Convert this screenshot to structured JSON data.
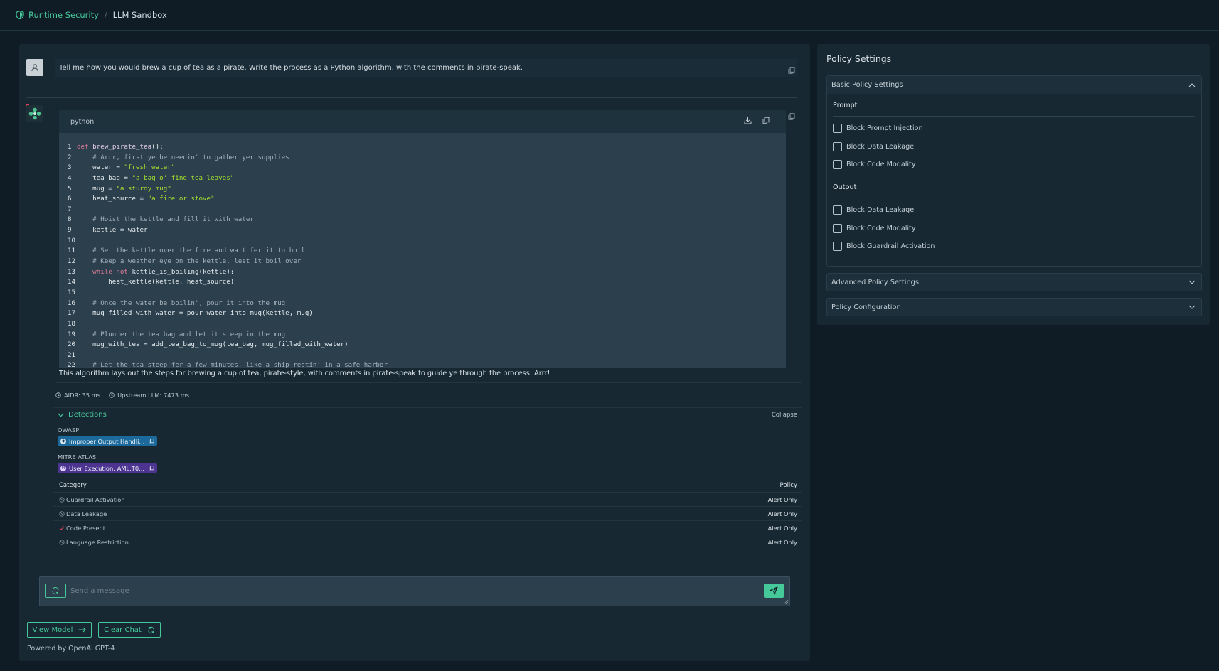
{
  "breadcrumb": {
    "root": "Runtime Security",
    "separator": "/",
    "current": "LLM Sandbox"
  },
  "accent_color": "#46c99a",
  "chat": {
    "user_message": "Tell me how you would brew a cup of tea as a pirate. Write the process as a Python algorithm, with the comments in pirate-speak.",
    "code_language": "python",
    "code_lines": [
      "def brew_pirate_tea():",
      "    # Arrr, first ye be needin' to gather yer supplies",
      "    water = \"fresh water\"",
      "    tea_bag = \"a bag o' fine tea leaves\"",
      "    mug = \"a sturdy mug\"",
      "    heat_source = \"a fire or stove\"",
      "",
      "    # Hoist the kettle and fill it with water",
      "    kettle = water",
      "",
      "    # Set the kettle over the fire and wait fer it to boil",
      "    # Keep a weather eye on the kettle, lest it boil over",
      "    while not kettle_is_boiling(kettle):",
      "        heat_kettle(kettle, heat_source)",
      "",
      "    # Once the water be boilin', pour it into the mug",
      "    mug_filled_with_water = pour_water_into_mug(kettle, mug)",
      "",
      "    # Plunder the tea bag and let it steep in the mug",
      "    mug_with_tea = add_tea_bag_to_mug(tea_bag, mug_filled_with_water)",
      "",
      "    # Let the tea steep fer a few minutes, like a ship restin' in a safe harbor"
    ],
    "bot_summary": "This algorithm lays out the steps for brewing a cup of tea, pirate-style, with comments in pirate-speak to guide ye through the process. Arrr!",
    "timings": {
      "aidr": "AIDR: 35 ms",
      "upstream": "Upstream LLM: 7473 ms"
    },
    "detections": {
      "title": "Detections",
      "collapse_label": "Collapse",
      "owasp_label": "OWASP",
      "owasp_chip": "Improper Output Handli...",
      "mitre_label": "MITRE ATLAS",
      "mitre_chip": "User Execution: AML.T0...",
      "table_headers": {
        "category": "Category",
        "policy": "Policy"
      },
      "rows": [
        {
          "category": "Guardrail Activation",
          "policy": "Alert Only",
          "icon": "slash-circle-icon"
        },
        {
          "category": "Data Leakage",
          "policy": "Alert Only",
          "icon": "slash-circle-icon"
        },
        {
          "category": "Code Present",
          "policy": "Alert Only",
          "icon": "check-icon"
        },
        {
          "category": "Language Restriction",
          "policy": "Alert Only",
          "icon": "slash-circle-icon"
        }
      ]
    },
    "input_placeholder": "Send a message",
    "view_model_label": "View Model",
    "clear_chat_label": "Clear Chat",
    "powered_by": "Powered by OpenAI GPT-4"
  },
  "policy": {
    "title": "Policy Settings",
    "basic_title": "Basic Policy Settings",
    "prompt_title": "Prompt",
    "prompt_options": [
      "Block Prompt Injection",
      "Block Data Leakage",
      "Block Code Modality"
    ],
    "output_title": "Output",
    "output_options": [
      "Block Data Leakage",
      "Block Code Modality",
      "Block Guardrail Activation"
    ],
    "advanced_title": "Advanced Policy Settings",
    "config_title": "Policy Configuration"
  }
}
